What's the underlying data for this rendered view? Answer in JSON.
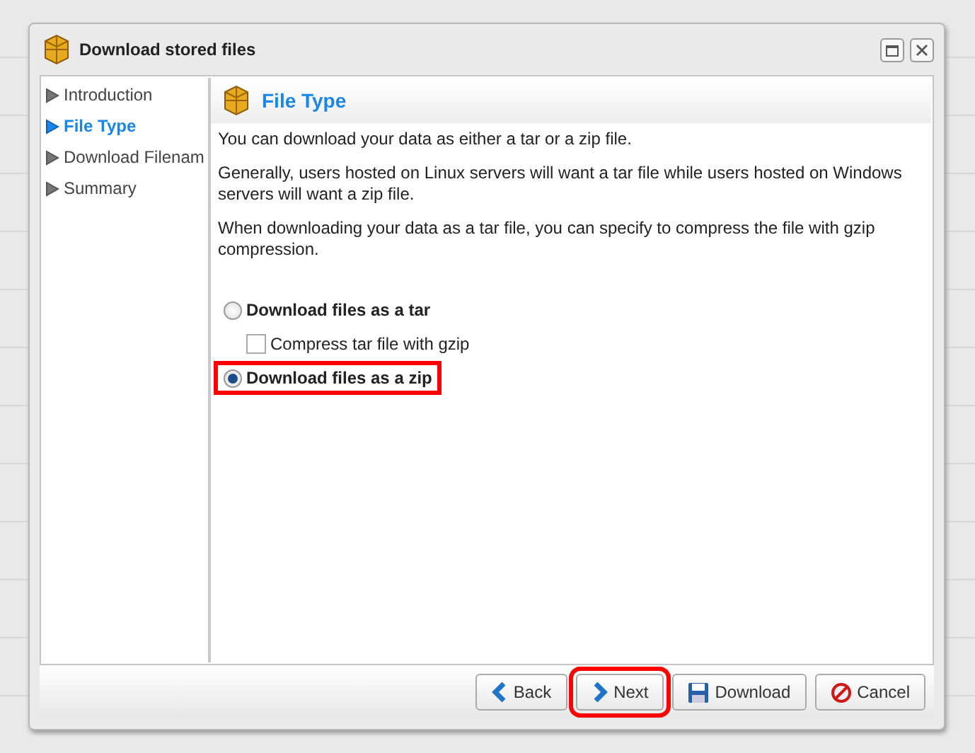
{
  "window": {
    "title": "Download stored files"
  },
  "sidebar": {
    "items": [
      {
        "label": "Introduction",
        "selected": false
      },
      {
        "label": "File Type",
        "selected": true
      },
      {
        "label": "Download Filenam",
        "selected": false
      },
      {
        "label": "Summary",
        "selected": false
      }
    ]
  },
  "panel": {
    "title": "File Type",
    "paragraphs": [
      "You can download your data as either a tar or a zip file.",
      "Generally, users hosted on Linux servers will want a tar file while users hosted on Windows servers will want a zip file.",
      "When downloading your data as a tar file, you can specify to compress the file with gzip compression."
    ],
    "options": [
      {
        "kind": "radio",
        "label": "Download files as a tar",
        "selected": false,
        "highlighted": false
      },
      {
        "kind": "checkbox",
        "label": "Compress tar file with gzip",
        "checked": false,
        "highlighted": false
      },
      {
        "kind": "radio",
        "label": "Download files as a zip",
        "selected": true,
        "highlighted": true
      }
    ]
  },
  "buttons": [
    {
      "kind": "back",
      "label": "Back",
      "highlighted": false
    },
    {
      "kind": "next",
      "label": "Next",
      "highlighted": true
    },
    {
      "kind": "download",
      "label": "Download",
      "highlighted": false
    },
    {
      "kind": "cancel",
      "label": "Cancel",
      "highlighted": false
    }
  ]
}
